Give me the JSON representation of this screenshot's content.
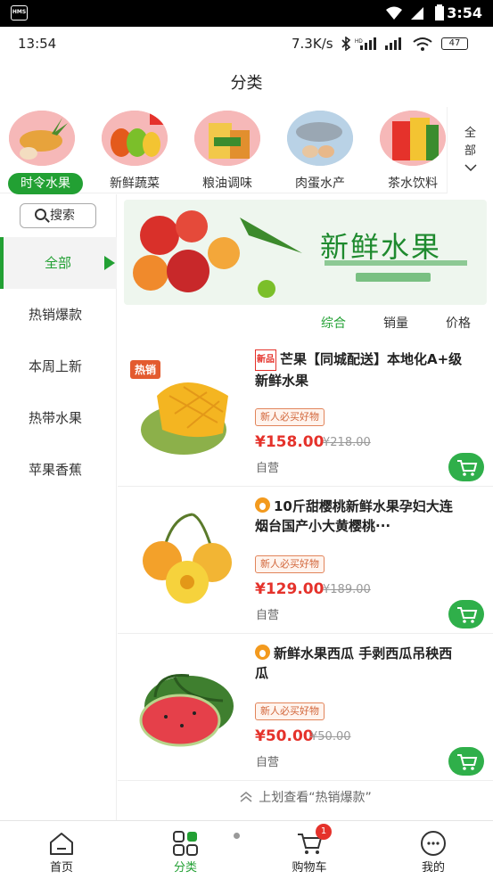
{
  "system": {
    "time": "3:54",
    "app_time": "13:54",
    "speed": "7.3K/s",
    "battery": "47",
    "hms": "HMS"
  },
  "header": {
    "title": "分类"
  },
  "categories": [
    {
      "label": "时令水果",
      "active": true
    },
    {
      "label": "新鲜蔬菜"
    },
    {
      "label": "粮油调味"
    },
    {
      "label": "肉蛋水产"
    },
    {
      "label": "茶水饮料"
    }
  ],
  "all_categories": {
    "label_top": "全",
    "label_bottom": "部"
  },
  "sidebar": {
    "search_label": "搜索",
    "items": [
      {
        "label": "全部"
      },
      {
        "label": "热销爆款"
      },
      {
        "label": "本周上新"
      },
      {
        "label": "热带水果"
      },
      {
        "label": "苹果香蕉"
      }
    ]
  },
  "banner": {
    "text": "新鲜水果"
  },
  "sort": {
    "comprehensive": "综合",
    "sales": "销量",
    "price": "价格"
  },
  "products": [
    {
      "new_badge": "新品",
      "hot_badge": "热销",
      "name": "芒果【同城配送】本地化A+级新鲜水果",
      "tag": "新人必买好物",
      "price": "¥158.00",
      "old_price": "¥218.00",
      "shipping": "自营"
    },
    {
      "name": "10斤甜樱桃新鲜水果孕妇大连烟台国产小大黄樱桃···",
      "tag": "新人必买好物",
      "price": "¥129.00",
      "old_price": "¥189.00",
      "shipping": "自营"
    },
    {
      "name": "新鲜水果西瓜 手剥西瓜吊秧西瓜",
      "tag": "新人必买好物",
      "price": "¥50.00",
      "old_price": "¥50.00",
      "shipping": "自营"
    }
  ],
  "swipe_hint": "上划查看“热销爆款”",
  "tabbar": {
    "items": [
      {
        "label": "首页"
      },
      {
        "label": "分类",
        "active": true
      },
      {
        "label": "购物车",
        "badge": "1"
      },
      {
        "label": "我的"
      }
    ]
  },
  "colors": {
    "accent": "#22a033",
    "price": "#e5322b"
  }
}
